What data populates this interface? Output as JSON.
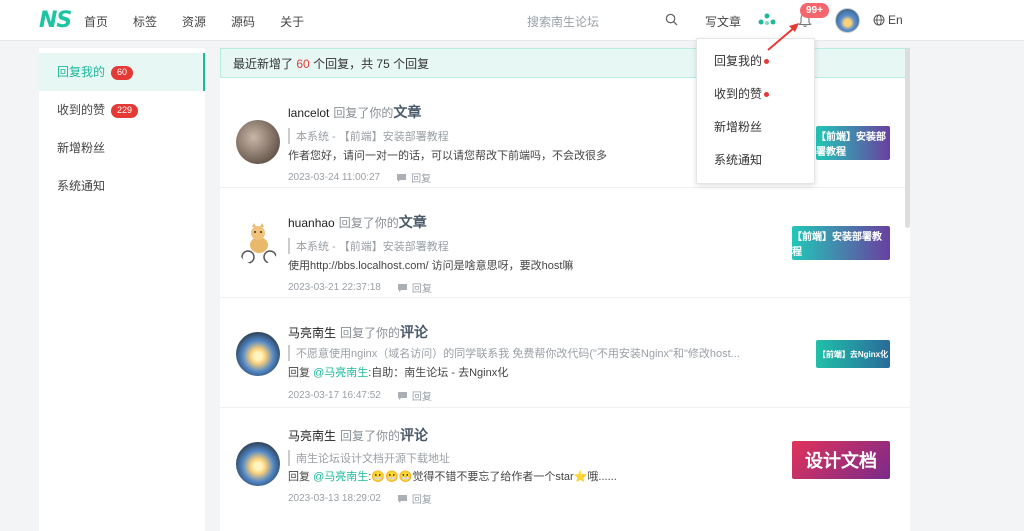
{
  "header": {
    "logo": "NS",
    "nav": [
      "首页",
      "标签",
      "资源",
      "源码",
      "关于"
    ],
    "search_placeholder": "搜索南生论坛",
    "write_label": "写文章",
    "notification_badge": "99+",
    "lang_label": "En"
  },
  "sidebar": {
    "items": [
      {
        "label": "回复我的",
        "badge": "60"
      },
      {
        "label": "收到的赞",
        "badge": "229"
      },
      {
        "label": "新增粉丝",
        "badge": ""
      },
      {
        "label": "系统通知",
        "badge": ""
      }
    ]
  },
  "banner": {
    "prefix": "最近新增了",
    "new_count": "60",
    "middle": "个回复，共",
    "total": "75",
    "suffix": "个回复"
  },
  "replies": [
    {
      "user": "lancelot",
      "action": "回复了你的",
      "target": "文章",
      "quote": "本系统 - 【前端】安装部署教程",
      "content": "作者您好，请问一对一的话，可以请您帮改下前端吗，不会改很多",
      "time": "2023-03-24 11:00:27",
      "reply_label": "回复",
      "thumb_text": "【前端】安装部署教程"
    },
    {
      "user": "huanhao",
      "action": "回复了你的",
      "target": "文章",
      "quote": "本系统 - 【前端】安装部署教程",
      "content": "使用http://bbs.localhost.com/ 访问是啥意思呀，要改host嘛",
      "time": "2023-03-21 22:37:18",
      "reply_label": "回复",
      "thumb_text": "【前端】安装部署教程"
    },
    {
      "user": "马亮南生",
      "action": "回复了你的",
      "target": "评论",
      "quote": "不愿意使用nginx（域名访问）的同学联系我 免费帮你改代码(\"不用安装Nginx\"和\"修改host...",
      "content_prefix": "回复",
      "mention": "@马亮南生",
      "content": ":自助：南生论坛 - 去Nginx化",
      "time": "2023-03-17 16:47:52",
      "reply_label": "回复",
      "thumb_text": "【前端】去Nginx化"
    },
    {
      "user": "马亮南生",
      "action": "回复了你的",
      "target": "评论",
      "quote": "南生论坛设计文档开源下载地址",
      "content_prefix": "回复",
      "mention": "@马亮南生",
      "content": ":😬😬😬觉得不错不要忘了给作者一个star⭐哦......",
      "time": "2023-03-13 18:29:02",
      "reply_label": "回复",
      "thumb_text": "设计文档"
    }
  ],
  "dropdown": {
    "items": [
      {
        "label": "回复我的",
        "dot": true
      },
      {
        "label": "收到的赞",
        "dot": true
      },
      {
        "label": "新增粉丝",
        "dot": false
      },
      {
        "label": "系统通知",
        "dot": false
      }
    ]
  },
  "colors": {
    "accent": "#1fb89b",
    "badge": "#e53935",
    "annotation_arrow": "#e53935"
  }
}
